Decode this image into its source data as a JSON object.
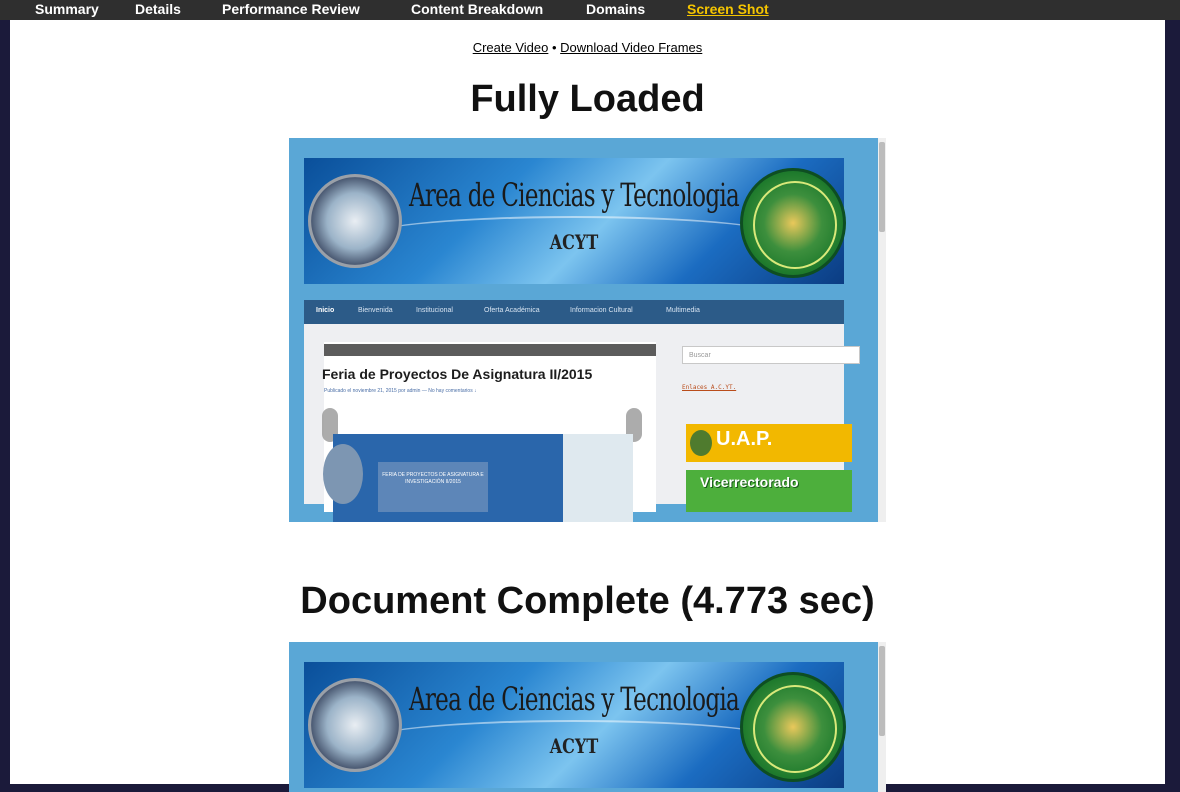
{
  "topnav": {
    "tabs": [
      {
        "label": "Summary",
        "active": false
      },
      {
        "label": "Details",
        "active": false
      },
      {
        "label": "Performance Review",
        "active": false
      },
      {
        "label": "Content Breakdown",
        "active": false
      },
      {
        "label": "Domains",
        "active": false
      },
      {
        "label": "Screen Shot",
        "active": true
      }
    ]
  },
  "links": {
    "create_video": "Create Video",
    "separator": "•",
    "download_frames": "Download Video Frames"
  },
  "sections": {
    "fully_loaded": "Fully Loaded",
    "document_complete": "Document Complete (4.773 sec)"
  },
  "screenshot": {
    "banner_title": "Area de Ciencias y Tecnologia",
    "banner_sub": "ACYT",
    "nav_items": [
      "Inicio",
      "Bienvenida",
      "Institucional",
      "Oferta Académica",
      "Informacion Cultural",
      "Multimedia"
    ],
    "post_title": "Feria de Proyectos De Asignatura II/2015",
    "post_meta": "Publicado el noviembre 21, 2015 por admin — No hay comentarios ↓",
    "slide_text": "FERIA DE PROYECTOS DE ASIGNATURA E INVESTIGACIÓN II/2015",
    "search_placeholder": "Buscar",
    "sidebar_heading": "Enlaces A.C.YT.",
    "sidebar_uap": "U.A.P.",
    "sidebar_vice": "Vicerrectorado"
  },
  "colors": {
    "topbar_bg": "#2f2f2f",
    "active_tab": "#f5c500",
    "page_bg": "#ffffff",
    "outer_bg": "#1b1a3a"
  }
}
